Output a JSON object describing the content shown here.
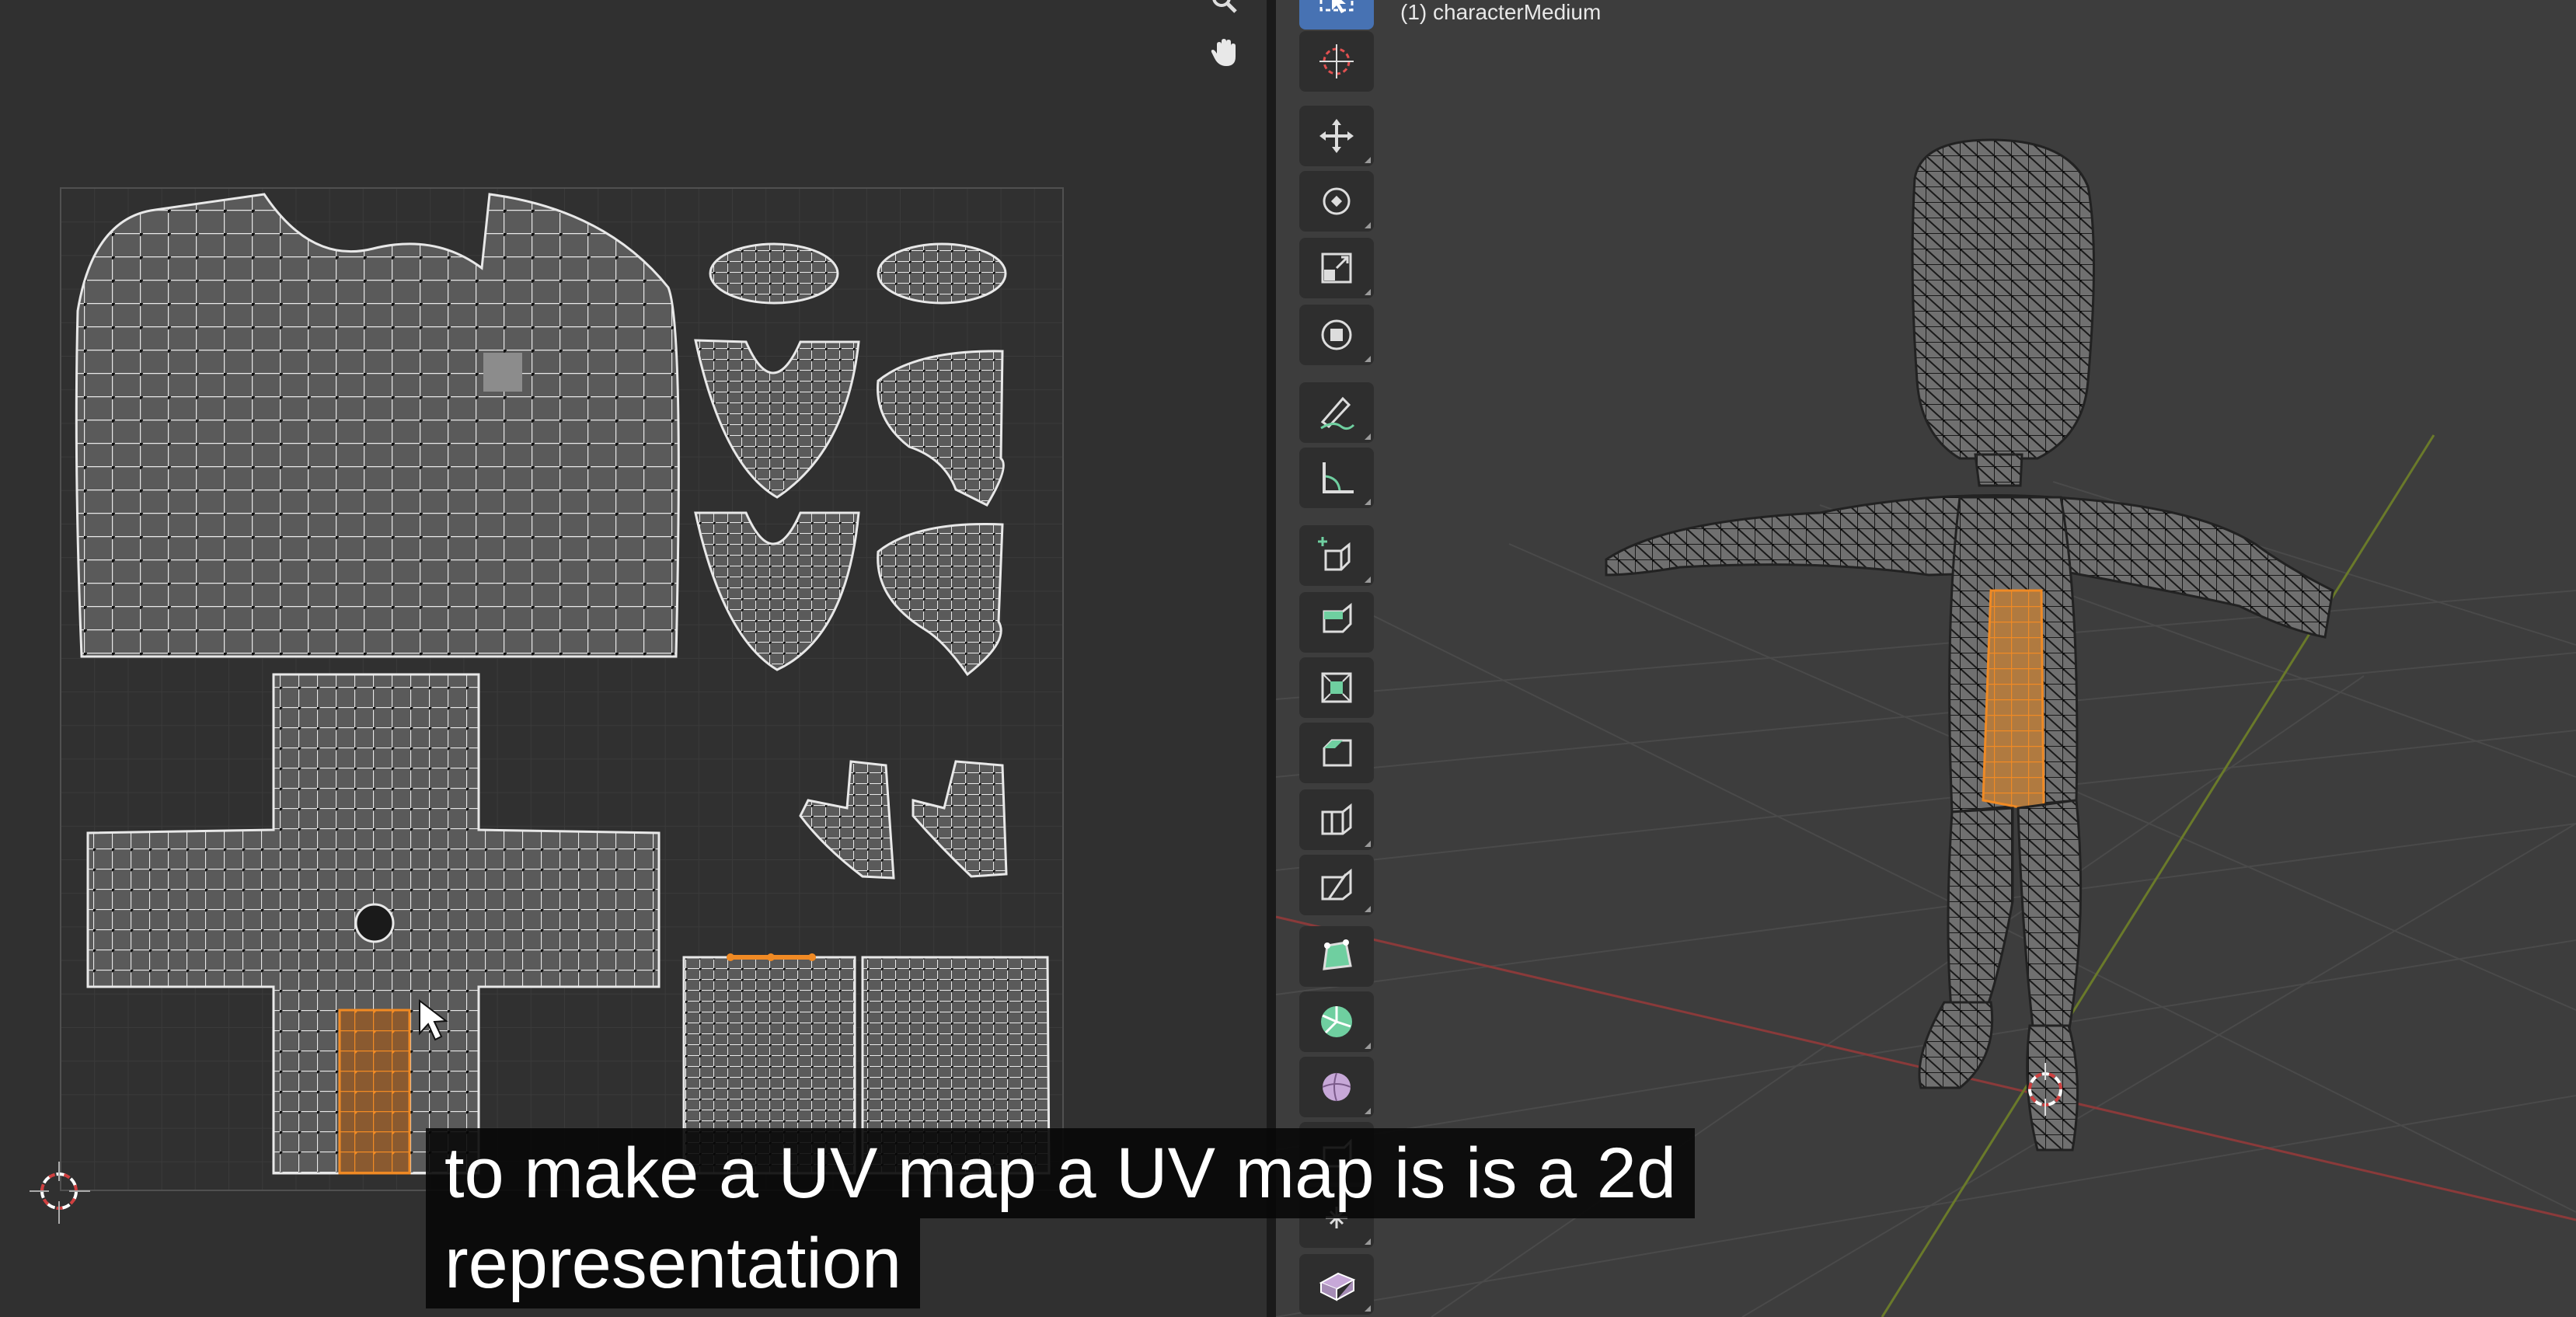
{
  "viewport": {
    "object_label": "(1) characterMedium"
  },
  "uv_editor": {
    "nav_icons": [
      "zoom-icon",
      "hand-pan-icon"
    ]
  },
  "toolbar": {
    "tools": [
      "select-box-icon",
      "cursor-icon",
      "move-icon",
      "rotate-icon",
      "scale-icon",
      "transform-icon",
      "annotate-icon",
      "measure-icon",
      "add-cube-icon",
      "extrude-icon",
      "inset-icon",
      "bevel-icon",
      "loop-cut-icon",
      "knife-icon",
      "poly-build-icon",
      "spin-icon",
      "smooth-icon",
      "edge-slide-icon",
      "shrink-fatten-icon",
      "shear-icon"
    ]
  },
  "subtitle": {
    "line1": "to make a UV map a UV map is is a 2d",
    "line2": "representation"
  },
  "colors": {
    "selection": "#f08a24",
    "active_tool": "#4772b3",
    "grid_red_axis": "#8a3a3a",
    "grid_green_axis": "#6a7a2a"
  }
}
